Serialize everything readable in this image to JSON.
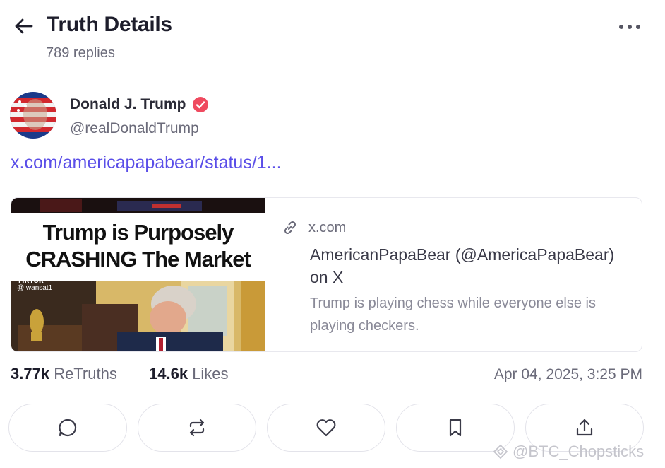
{
  "header": {
    "title": "Truth Details",
    "replies": "789 replies"
  },
  "author": {
    "name": "Donald J. Trump",
    "handle": "@realDonaldTrump"
  },
  "post": {
    "link_text": "x.com/americapapabear/status/1..."
  },
  "card": {
    "thumb_headline_line1": "Trump is Purposely",
    "thumb_headline_line2": "CRASHING The Market",
    "thumb_overlay_app": "TikTok",
    "thumb_overlay_user": "@ wansat1",
    "domain": "x.com",
    "title": "AmericanPapaBear (@AmericaPapaBear) on X",
    "description": "Trump is playing chess while everyone else is playing checkers."
  },
  "stats": {
    "retruths_count": "3.77k",
    "retruths_label": "ReTruths",
    "likes_count": "14.6k",
    "likes_label": "Likes",
    "timestamp": "Apr 04, 2025, 3:25 PM"
  },
  "watermark": "@BTC_Chopsticks",
  "colors": {
    "link": "#5a4ee8",
    "verified": "#ef4a5f",
    "text_muted": "#6b6b7a"
  },
  "icons": [
    "back-arrow-icon",
    "more-dots-icon",
    "verified-badge-icon",
    "link-icon",
    "reply-icon",
    "retruth-icon",
    "like-icon",
    "bookmark-icon",
    "share-icon"
  ]
}
